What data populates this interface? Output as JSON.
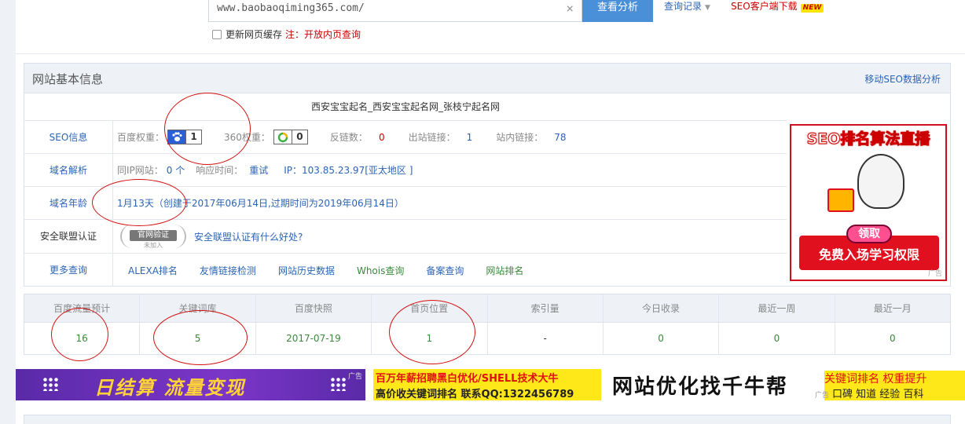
{
  "search": {
    "url": "www.baobaoqiming365.com/",
    "clear_icon": "×",
    "analyze_label": "查看分析",
    "history_label": "查询记录",
    "client_download": "SEO客户端下载",
    "new_badge": "NEW",
    "refresh_cache": "更新网页缓存",
    "note": "注：开放内页查询"
  },
  "panel": {
    "title": "网站基本信息",
    "mobile_link": "移动SEO数据分析",
    "site_title": "西安宝宝起名_西安宝宝起名网_张枝宁起名网",
    "seo": {
      "label": "SEO信息",
      "baidu_weight_label": "百度权重：",
      "baidu_weight": "1",
      "weight360_label": "360权重：",
      "weight360": "0",
      "backlinks_label": "反链数：",
      "backlinks": "0",
      "outbound_label": "出站链接：",
      "outbound": "1",
      "internal_label": "站内链接：",
      "internal": "78"
    },
    "dns": {
      "label": "域名解析",
      "same_ip_label": "同IP网站：",
      "same_ip": "0 个",
      "response_label": "响应时间：",
      "retry": "重试",
      "ip": "IP：103.85.23.97[亚太地区 ]"
    },
    "age": {
      "label": "域名年龄",
      "value": "1月13天（创建于2017年06月14日,过期时间为2019年06月14日）"
    },
    "security": {
      "label": "安全联盟认证",
      "badge_text": "官网验证",
      "badge_sub": "未加入",
      "link": "安全联盟认证有什么好处?"
    },
    "more": {
      "label": "更多查询",
      "links": [
        "ALEXA排名",
        "友情链接检测",
        "网站历史数据",
        "Whois查询",
        "备案查询",
        "网站排名"
      ]
    }
  },
  "ad_right": {
    "title": "SEO排名算法直播",
    "pill": "领取",
    "button": "免费入场学习权限",
    "tag": "广告"
  },
  "stats": {
    "headers": [
      "百度流量预计",
      "关键词库",
      "百度快照",
      "首页位置",
      "索引量",
      "今日收录",
      "最近一周",
      "最近一月"
    ],
    "values": [
      "16",
      "5",
      "2017-07-19",
      "1",
      "-",
      "0",
      "0",
      "0"
    ]
  },
  "bottom_ads": {
    "ad1": "日结算 流量变现",
    "ad1_tag": "广告",
    "ad2_line1": "百万年薪招聘黑白优化/SHELL技术大牛",
    "ad2_line2": "高价收关键词排名  联系QQ:1322456789",
    "ad3_main": "网站优化找千牛帮",
    "ad3_side1": "关键词排名  权重提升",
    "ad3_side2": "口碑  知道  经验  百科",
    "ad3_tag": "广告"
  }
}
